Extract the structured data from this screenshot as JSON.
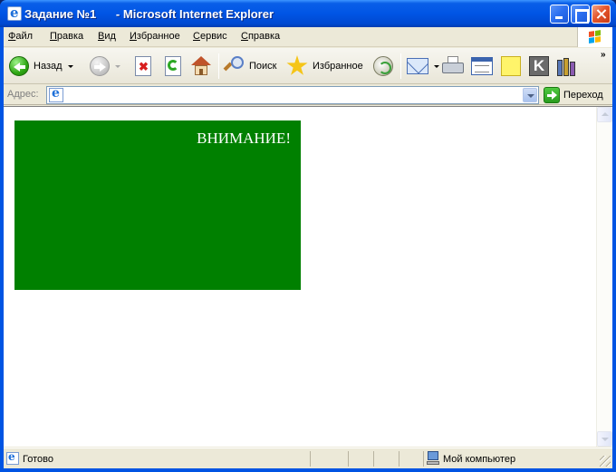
{
  "window": {
    "title": "Задание №1      - Microsoft Internet Explorer"
  },
  "menu": {
    "items": [
      {
        "u": "Ф",
        "rest": "айл"
      },
      {
        "u": "П",
        "rest": "равка"
      },
      {
        "u": "В",
        "rest": "ид"
      },
      {
        "u": "И",
        "rest": "збранное"
      },
      {
        "u": "С",
        "rest": "ервис"
      },
      {
        "u": "С",
        "rest": "правка"
      }
    ]
  },
  "toolbar": {
    "back_label": "Назад",
    "search_label": "Поиск",
    "favorites_label": "Избранное",
    "overflow": "»"
  },
  "address": {
    "label": "Адрес:",
    "value": "",
    "go_label": "Переход"
  },
  "page": {
    "box_color": "#008000",
    "warning_text": "ВНИМАНИЕ!"
  },
  "status": {
    "text": "Готово",
    "zone": "Мой компьютер"
  }
}
